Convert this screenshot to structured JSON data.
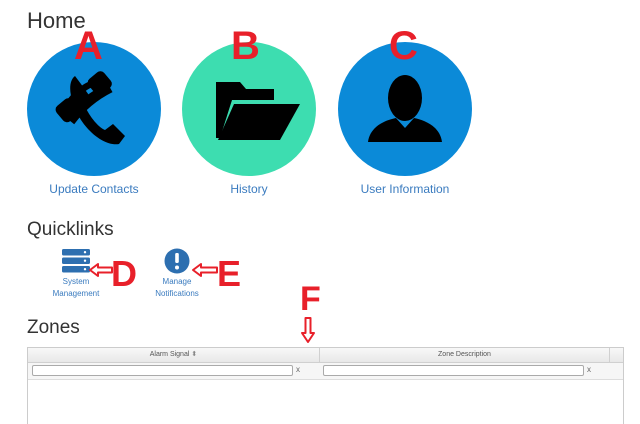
{
  "home": {
    "title": "Home",
    "tiles": [
      {
        "label": "Update Contacts",
        "icon": "phone-icon",
        "color": "#0b8ad8",
        "marker": "A"
      },
      {
        "label": "History",
        "icon": "folder-open-icon",
        "color": "#3dddb0",
        "marker": "B"
      },
      {
        "label": "User Information",
        "icon": "user-icon",
        "color": "#0b8ad8",
        "marker": "C"
      }
    ]
  },
  "quicklinks": {
    "title": "Quicklinks",
    "items": [
      {
        "label_line1": "System",
        "label_line2": "Management",
        "icon": "server-icon",
        "marker": "D"
      },
      {
        "label_line1": "Manage",
        "label_line2": "Notifications",
        "icon": "exclamation-circle-icon",
        "marker": "E"
      }
    ]
  },
  "zones": {
    "title": "Zones",
    "marker": "F",
    "columns": [
      {
        "header": "Alarm Signal",
        "sortable": true,
        "filter_value": "",
        "clear": "x"
      },
      {
        "header": "Zone Description",
        "sortable": false,
        "filter_value": "",
        "clear": "x"
      }
    ]
  },
  "colors": {
    "link": "#3a7bbf",
    "marker": "#e8202a",
    "tile_blue": "#0b8ad8",
    "tile_green": "#3dddb0",
    "icon_blue": "#2d6fb0"
  }
}
